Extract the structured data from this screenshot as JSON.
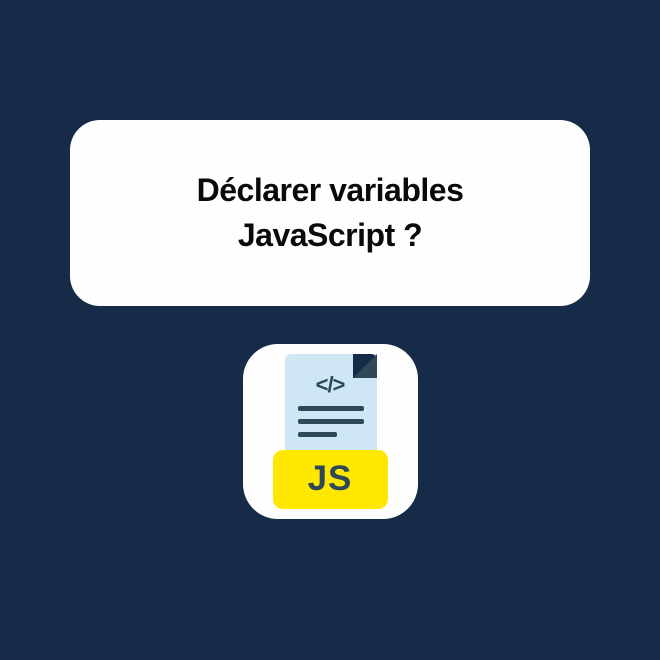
{
  "title": {
    "line1": "Déclarer variables",
    "line2": "JavaScript ?"
  },
  "icon": {
    "code_symbol": "</>",
    "label": "JS"
  },
  "colors": {
    "background": "#152B48",
    "card": "#FEFEFE",
    "file_body": "#CFE6F4",
    "file_dark": "#2F4858",
    "js_yellow": "#FEE800"
  }
}
